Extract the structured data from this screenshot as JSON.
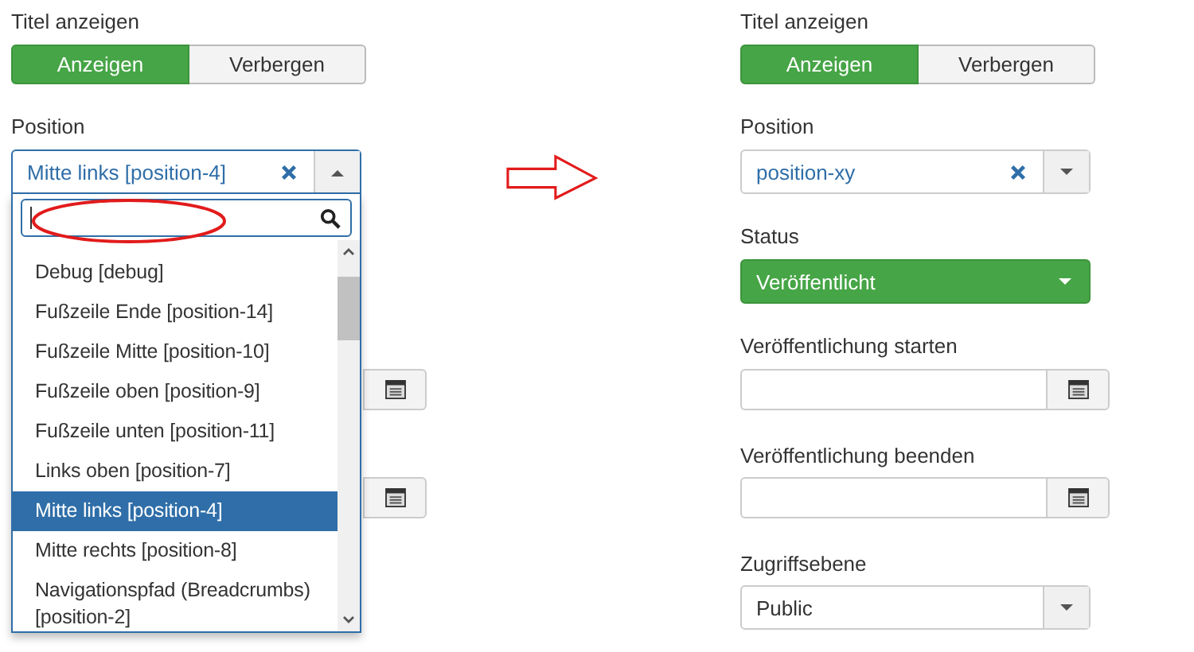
{
  "left": {
    "show_title": {
      "label": "Titel anzeigen",
      "options": [
        {
          "label": "Anzeigen",
          "selected": true
        },
        {
          "label": "Verbergen",
          "selected": false
        }
      ]
    },
    "position": {
      "label": "Position",
      "value": "Mitte links [position-4]",
      "open": true,
      "options": [
        {
          "label": "Debug [debug]",
          "selected": false
        },
        {
          "label": "Fußzeile Ende [position-14]",
          "selected": false
        },
        {
          "label": "Fußzeile Mitte [position-10]",
          "selected": false
        },
        {
          "label": "Fußzeile oben [position-9]",
          "selected": false
        },
        {
          "label": "Fußzeile unten [position-11]",
          "selected": false
        },
        {
          "label": "Links oben [position-7]",
          "selected": false
        },
        {
          "label": "Mitte links [position-4]",
          "selected": true
        },
        {
          "label": "Mitte rechts [position-8]",
          "selected": false
        },
        {
          "label": "Navigationspfad (Breadcrumbs) [position-2]",
          "selected": false
        }
      ]
    }
  },
  "right": {
    "show_title": {
      "label": "Titel anzeigen",
      "options": [
        {
          "label": "Anzeigen",
          "selected": true
        },
        {
          "label": "Verbergen",
          "selected": false
        }
      ]
    },
    "position": {
      "label": "Position",
      "value": "position-xy",
      "open": false
    },
    "status": {
      "label": "Status",
      "value": "Veröffentlicht"
    },
    "publish_up": {
      "label": "Veröffentlichung starten"
    },
    "publish_down": {
      "label": "Veröffentlichung beenden"
    },
    "access": {
      "label": "Zugriffsebene",
      "value": "Public"
    }
  }
}
